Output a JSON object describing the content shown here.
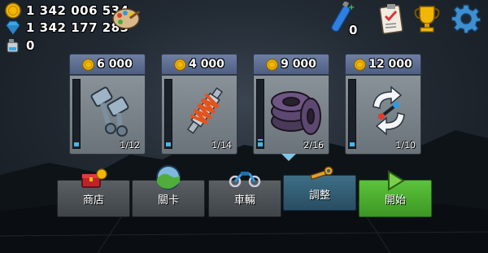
{
  "stats": {
    "coins": "1 342 006 534",
    "gems": "1 342 177 283",
    "fuel": "0"
  },
  "top_right": {
    "potion_count": "0"
  },
  "upgrades": [
    {
      "price": "6 000",
      "level": "1/12",
      "progress": 0.083,
      "item": "engine"
    },
    {
      "price": "4 000",
      "level": "1/14",
      "progress": 0.071,
      "item": "suspension"
    },
    {
      "price": "9 000",
      "level": "2/16",
      "progress": 0.125,
      "item": "tires"
    },
    {
      "price": "12 000",
      "level": "1/10",
      "progress": 0.1,
      "item": "4wd"
    }
  ],
  "tabs": {
    "shop": "商店",
    "stages": "關卡",
    "vehicles": "車輛",
    "tuning": "調整",
    "start": "開始"
  },
  "colors": {
    "coin": "#f2b705",
    "gem": "#3aa8e8",
    "start_green": "#4aac2e",
    "active_tab": "#33607a"
  }
}
